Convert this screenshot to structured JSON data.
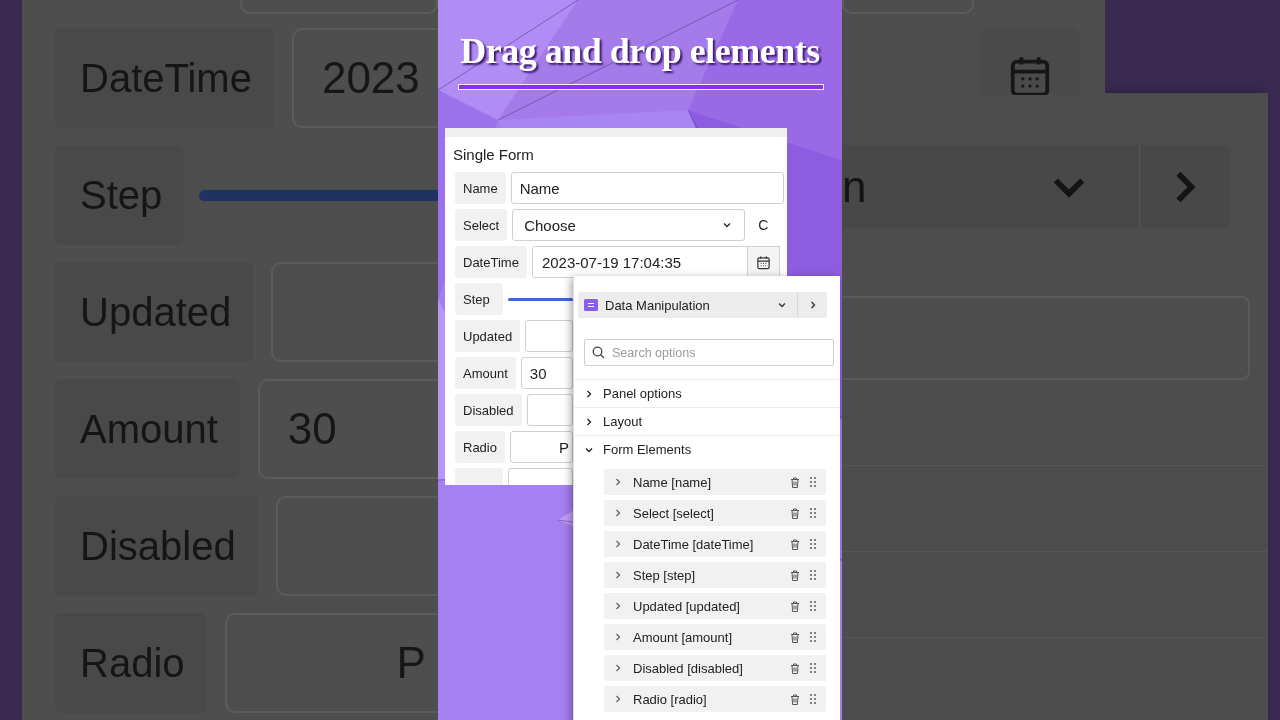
{
  "title": "Drag and drop elements",
  "backdrop_left": {
    "rows": [
      {
        "label": "DateTime",
        "kind": "input",
        "value": "2023"
      },
      {
        "label": "Step",
        "kind": "slider"
      },
      {
        "label": "Updated",
        "kind": "input"
      },
      {
        "label": "Amount",
        "kind": "input",
        "value": "30"
      },
      {
        "label": "Disabled",
        "kind": "input"
      },
      {
        "label": "Radio",
        "kind": "radio",
        "value": "P"
      }
    ]
  },
  "form": {
    "title": "Single Form",
    "rows": [
      {
        "label": "Name",
        "kind": "input",
        "value": "Name"
      },
      {
        "label": "Select",
        "kind": "select",
        "value": "Choose",
        "extra": "C"
      },
      {
        "label": "DateTime",
        "kind": "datetime",
        "value": "2023-07-19 17:04:35"
      },
      {
        "label": "Step",
        "kind": "slider"
      },
      {
        "label": "Updated",
        "kind": "input"
      },
      {
        "label": "Amount",
        "kind": "input",
        "value": "30"
      },
      {
        "label": "Disabled",
        "kind": "input"
      },
      {
        "label": "Radio",
        "kind": "radio",
        "value": "P"
      },
      {
        "kind": "input"
      }
    ]
  },
  "options_panel": {
    "selector": "Data Manipulation",
    "search": {
      "placeholder": "Search options"
    },
    "sections": [
      {
        "label": "Panel options",
        "expanded": false
      },
      {
        "label": "Layout",
        "expanded": false
      },
      {
        "label": "Form Elements",
        "expanded": true,
        "children": [
          {
            "label": "Name [name]"
          },
          {
            "label": "Select [select]"
          },
          {
            "label": "DateTime [dateTime]"
          },
          {
            "label": "Step [step]"
          },
          {
            "label": "Updated [updated]"
          },
          {
            "label": "Amount [amount]"
          },
          {
            "label": "Disabled [disabled]"
          },
          {
            "label": "Radio [radio]"
          }
        ]
      }
    ]
  },
  "backdrop_right": {
    "selector": "n"
  }
}
